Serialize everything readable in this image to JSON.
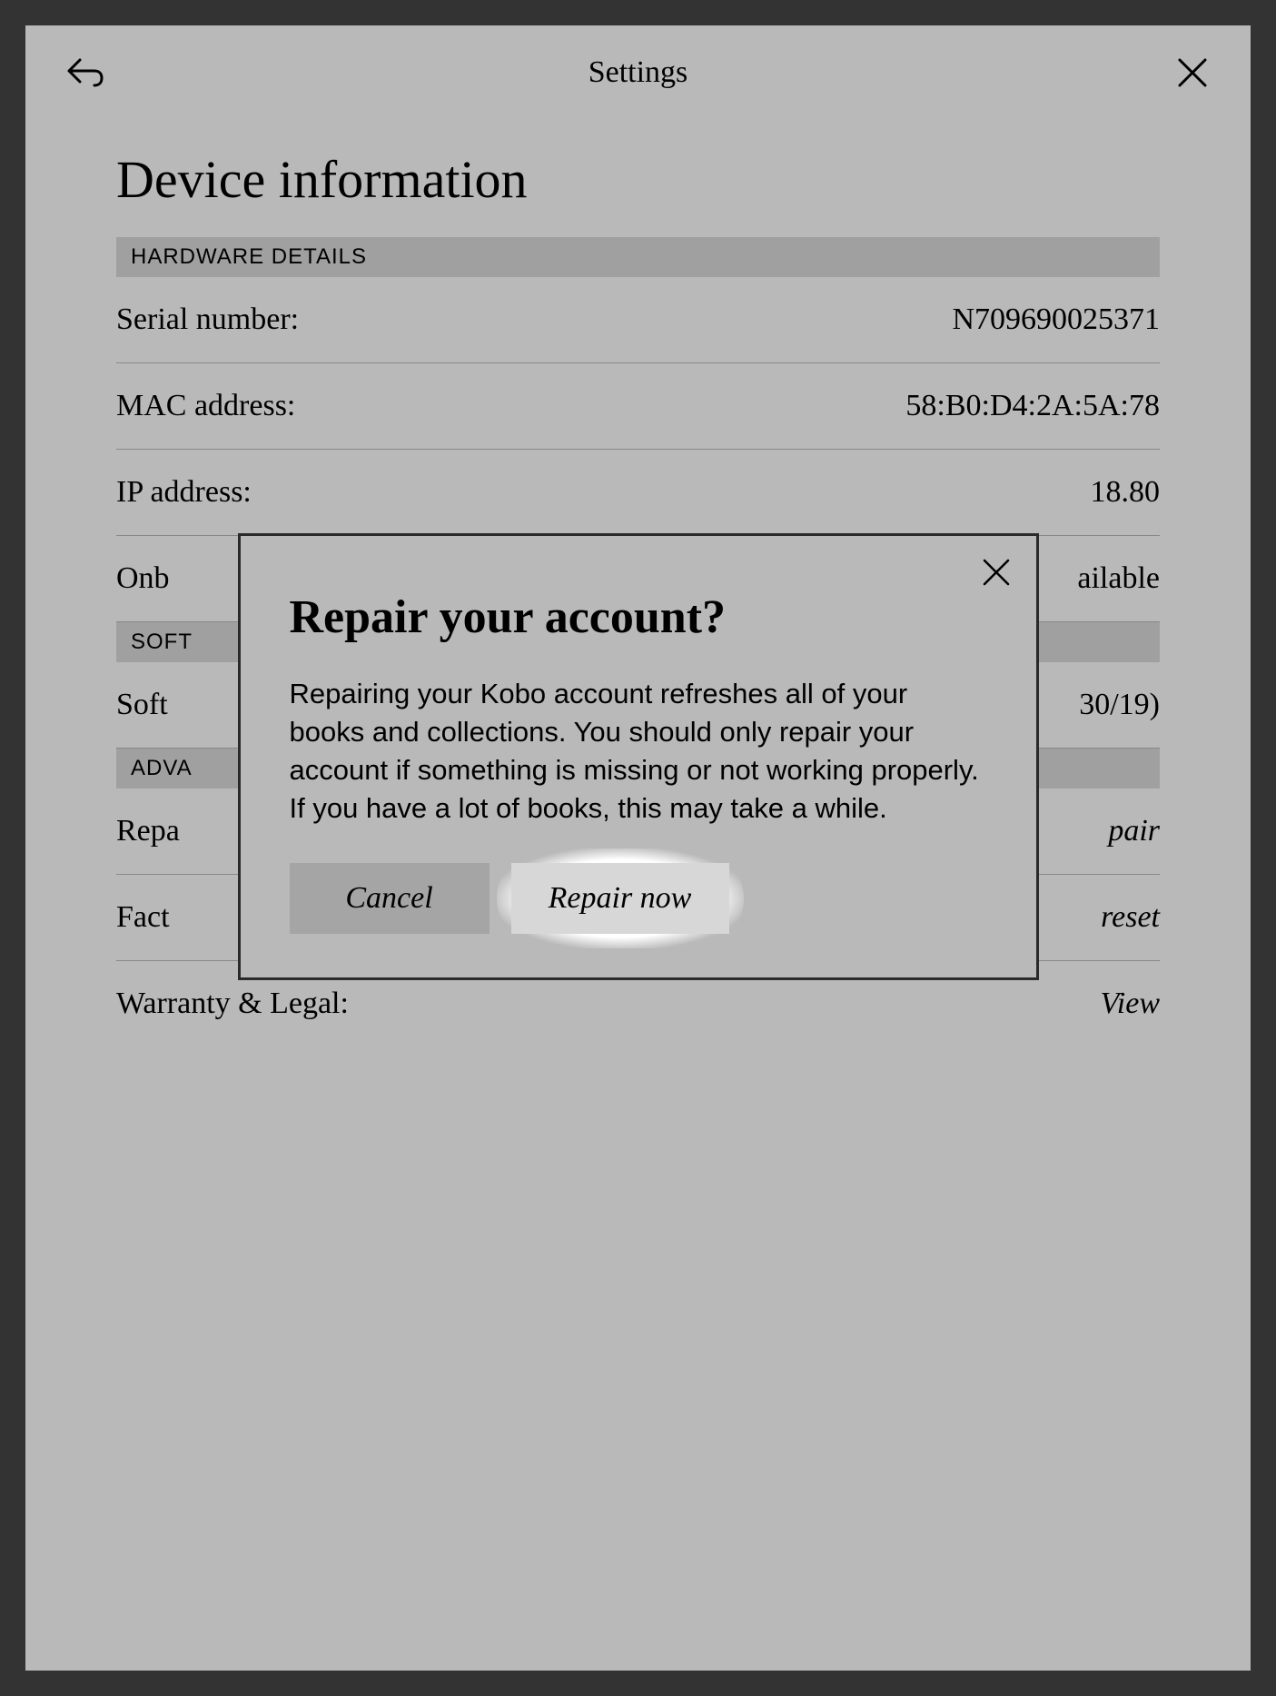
{
  "topbar": {
    "title": "Settings"
  },
  "page": {
    "title": "Device information"
  },
  "sections": {
    "hardware": {
      "header": "HARDWARE DETAILS",
      "serial_label": "Serial number:",
      "serial_value": "N709690025371",
      "mac_label": "MAC address:",
      "mac_value": "58:B0:D4:2A:5A:78",
      "ip_label": "IP address:",
      "ip_value_partial": "18.80",
      "storage_label_partial": "Onb",
      "storage_value_partial": "ailable"
    },
    "software": {
      "header_partial": "SOFT",
      "version_label_partial": "Soft",
      "version_value_partial": "30/19)"
    },
    "advanced": {
      "header_partial": "ADVA",
      "repair_label_partial": "Repa",
      "repair_action_partial": "pair",
      "factory_label_partial": "Fact",
      "factory_action_partial": "reset"
    },
    "warranty": {
      "label": "Warranty & Legal:",
      "action": "View"
    }
  },
  "modal": {
    "title": "Repair your account?",
    "body": "Repairing your Kobo account refreshes all of your books and collections. You should only repair your account if something is missing or not working properly. If you have a lot of books, this may take a while.",
    "cancel": "Cancel",
    "confirm": "Repair now"
  }
}
